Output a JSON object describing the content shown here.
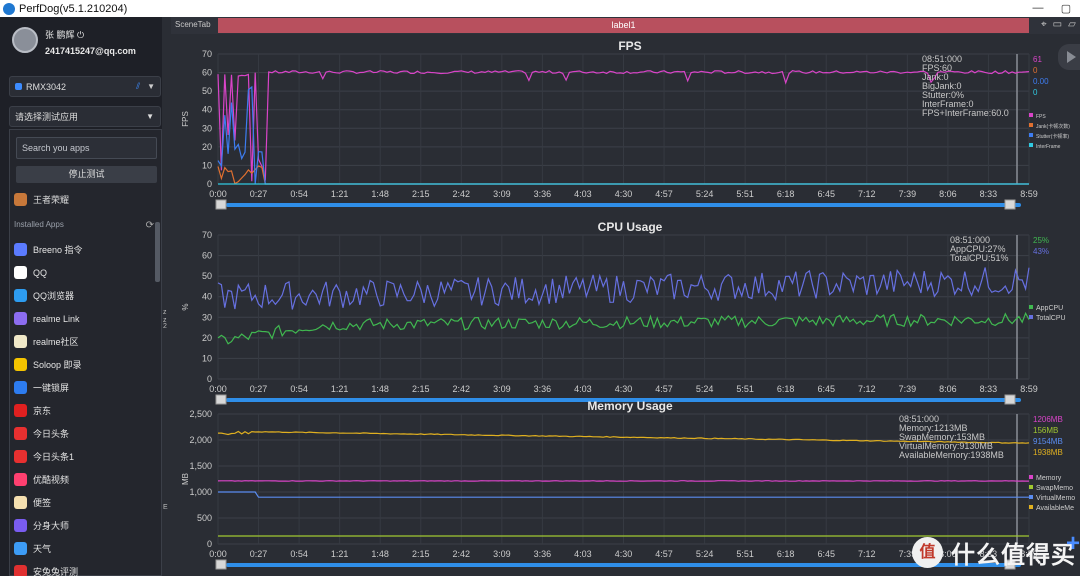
{
  "window": {
    "title": "PerfDog(v5.1.210204)"
  },
  "user": {
    "name": "张 鹏辉 ⏻",
    "email": "2417415247@qq.com"
  },
  "device": {
    "name": "RMX3042"
  },
  "app_select": {
    "label": "请选择测试应用"
  },
  "search": {
    "placeholder": "Search you apps"
  },
  "stop_button": {
    "label": "停止测试"
  },
  "recent_app": {
    "label": "王者荣耀"
  },
  "installed": {
    "label": "Installed Apps"
  },
  "apps": [
    {
      "label": "Breeno 指令",
      "color": "#5b7bff"
    },
    {
      "label": "QQ",
      "color": "#ffffff"
    },
    {
      "label": "QQ浏览器",
      "color": "#2d9cf0"
    },
    {
      "label": "realme Link",
      "color": "#8c6cf0"
    },
    {
      "label": "realme社区",
      "color": "#f0e8c8"
    },
    {
      "label": "Soloop 即录",
      "color": "#f5c400"
    },
    {
      "label": "一键锁屏",
      "color": "#2d7cf0"
    },
    {
      "label": "京东",
      "color": "#e02020"
    },
    {
      "label": "今日头条",
      "color": "#e83030"
    },
    {
      "label": "今日头条1",
      "color": "#e83030"
    },
    {
      "label": "优酷视频",
      "color": "#ff4070"
    },
    {
      "label": "便签",
      "color": "#f5e0b0"
    },
    {
      "label": "分身大师",
      "color": "#7a5cf0"
    },
    {
      "label": "天气",
      "color": "#3d9cf5"
    },
    {
      "label": "安兔兔评测",
      "color": "#e03030"
    }
  ],
  "scene": {
    "tab_label": "SceneTab",
    "current_label": "label1"
  },
  "midcol_labels": [
    "z",
    "z",
    "2",
    "E"
  ],
  "x_ticks": [
    "0:00",
    "0:27",
    "0:54",
    "1:21",
    "1:48",
    "2:15",
    "2:42",
    "3:09",
    "3:36",
    "4:03",
    "4:30",
    "4:57",
    "5:24",
    "5:51",
    "6:18",
    "6:45",
    "7:12",
    "7:39",
    "8:06",
    "8:33",
    "8:59"
  ],
  "chart_data": [
    {
      "type": "line",
      "title": "FPS",
      "ylabel": "FPS",
      "ylim": [
        0,
        70
      ],
      "yticks": [
        0,
        10,
        20,
        30,
        40,
        50,
        60,
        70
      ],
      "series": [
        {
          "name": "FPS",
          "color": "#d944c8",
          "summary": "61",
          "level": 60
        },
        {
          "name": "Jank(卡顿次数)",
          "color": "#e07030",
          "summary": "0",
          "level": 0
        },
        {
          "name": "Stutter(卡顿率)",
          "color": "#3d7cf0",
          "summary": "0.00",
          "level": 0
        },
        {
          "name": "InterFrame",
          "color": "#30c8e0",
          "summary": "0",
          "level": 0
        }
      ],
      "tooltip": [
        "08:51:000",
        "FPS:60",
        "Jank:0",
        "BigJank:0",
        "Stutter:0%",
        "InterFrame:0",
        "FPS+InterFrame:60.0"
      ]
    },
    {
      "type": "line",
      "title": "CPU Usage",
      "ylabel": "%",
      "ylim": [
        0,
        70
      ],
      "yticks": [
        0,
        10,
        20,
        30,
        40,
        50,
        60,
        70
      ],
      "series": [
        {
          "name": "AppCPU",
          "color": "#40b850",
          "summary": "25%",
          "level": 28
        },
        {
          "name": "TotalCPU",
          "color": "#6670e0",
          "summary": "43%",
          "level": 50
        }
      ],
      "tooltip": [
        "08:51:000",
        "AppCPU:27%",
        "TotalCPU:51%"
      ]
    },
    {
      "type": "line",
      "title": "Memory Usage",
      "ylabel": "MB",
      "ylim": [
        0,
        2500
      ],
      "yticks": [
        0,
        500,
        1000,
        1500,
        2000,
        2500
      ],
      "ytick_labels": [
        "0",
        "500",
        "1,000",
        "1,500",
        "2,000",
        "2,500"
      ],
      "series": [
        {
          "name": "Memory",
          "color": "#d944c8",
          "summary": "1206MB",
          "level": 1213
        },
        {
          "name": "SwapMemory",
          "color": "#a0c830",
          "summary": "156MB",
          "level": 153
        },
        {
          "name": "VirtualMemory",
          "color": "#5a8cf0",
          "summary": "9154MB",
          "level": 9130
        },
        {
          "name": "AvailableMemory",
          "color": "#e0b020",
          "summary": "1938MB",
          "level": 1938
        }
      ],
      "legend_labels": [
        "Memory",
        "SwapMemo",
        "VirtualMemo",
        "AvailableMe"
      ],
      "tooltip": [
        "08:51:000",
        "Memory:1213MB",
        "SwapMemory:153MB",
        "VirtualMemory:9130MB",
        "AvailableMemory:1938MB"
      ]
    }
  ],
  "watermark": {
    "logo": "值",
    "text": "什么值得买"
  }
}
